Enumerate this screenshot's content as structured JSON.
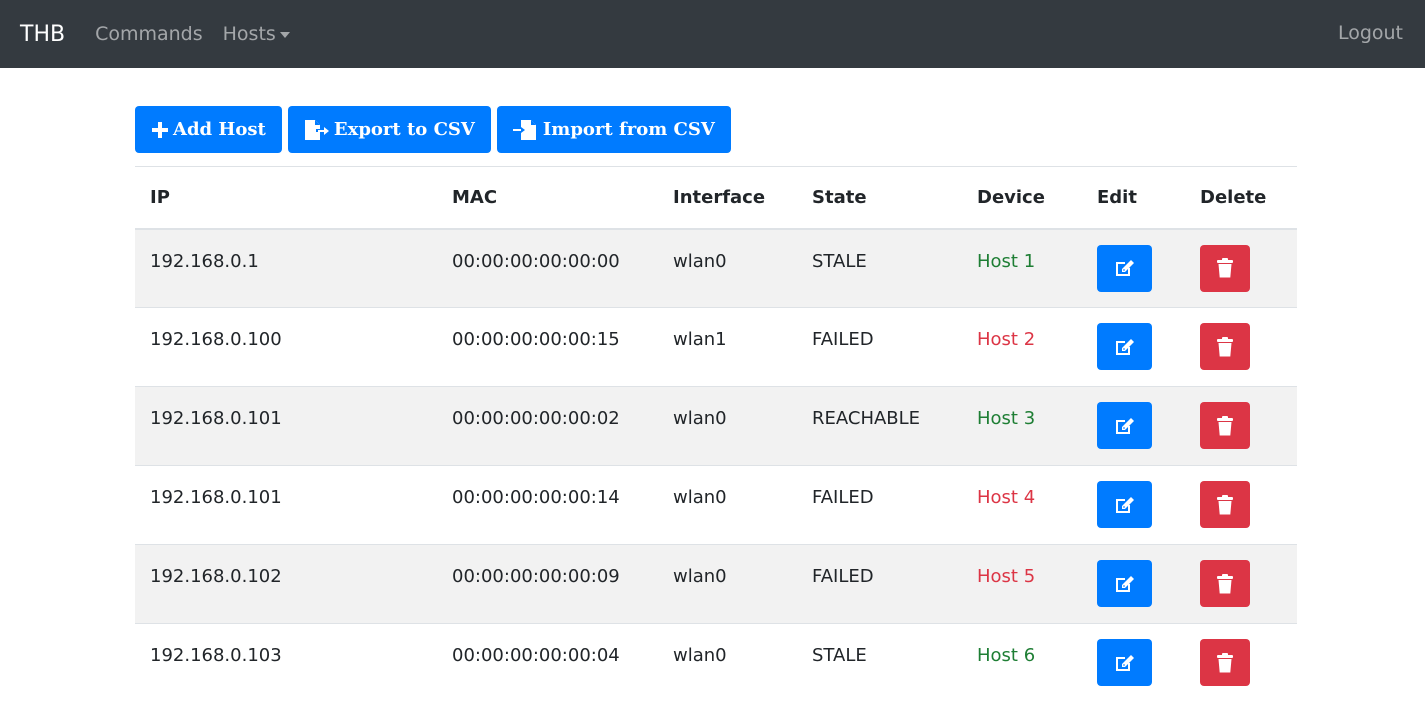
{
  "navbar": {
    "brand": "THB",
    "links": {
      "commands": "Commands",
      "hosts": "Hosts"
    },
    "logout": "Logout"
  },
  "toolbar": {
    "add_host": "Add Host",
    "export_csv": "Export to CSV",
    "import_csv": "Import from CSV"
  },
  "table": {
    "headers": {
      "ip": "IP",
      "mac": "MAC",
      "interface": "Interface",
      "state": "State",
      "device": "Device",
      "edit": "Edit",
      "delete": "Delete"
    },
    "rows": [
      {
        "ip": "192.168.0.1",
        "mac": "00:00:00:00:00:00",
        "interface": "wlan0",
        "state": "STALE",
        "device": "Host 1",
        "device_color": "#1e7e34"
      },
      {
        "ip": "192.168.0.100",
        "mac": "00:00:00:00:00:15",
        "interface": "wlan1",
        "state": "FAILED",
        "device": "Host 2",
        "device_color": "#dc3545"
      },
      {
        "ip": "192.168.0.101",
        "mac": "00:00:00:00:00:02",
        "interface": "wlan0",
        "state": "REACHABLE",
        "device": "Host 3",
        "device_color": "#1e7e34"
      },
      {
        "ip": "192.168.0.101",
        "mac": "00:00:00:00:00:14",
        "interface": "wlan0",
        "state": "FAILED",
        "device": "Host 4",
        "device_color": "#dc3545"
      },
      {
        "ip": "192.168.0.102",
        "mac": "00:00:00:00:00:09",
        "interface": "wlan0",
        "state": "FAILED",
        "device": "Host 5",
        "device_color": "#dc3545"
      },
      {
        "ip": "192.168.0.103",
        "mac": "00:00:00:00:00:04",
        "interface": "wlan0",
        "state": "STALE",
        "device": "Host 6",
        "device_color": "#1e7e34"
      }
    ]
  },
  "colors": {
    "navbar_bg": "#343a40",
    "primary": "#007bff",
    "danger": "#dc3545",
    "success": "#1e7e34"
  },
  "icons": {
    "add": "plus-icon",
    "export": "file-export-icon",
    "import": "file-import-icon",
    "edit": "edit-icon",
    "delete": "trash-icon"
  }
}
